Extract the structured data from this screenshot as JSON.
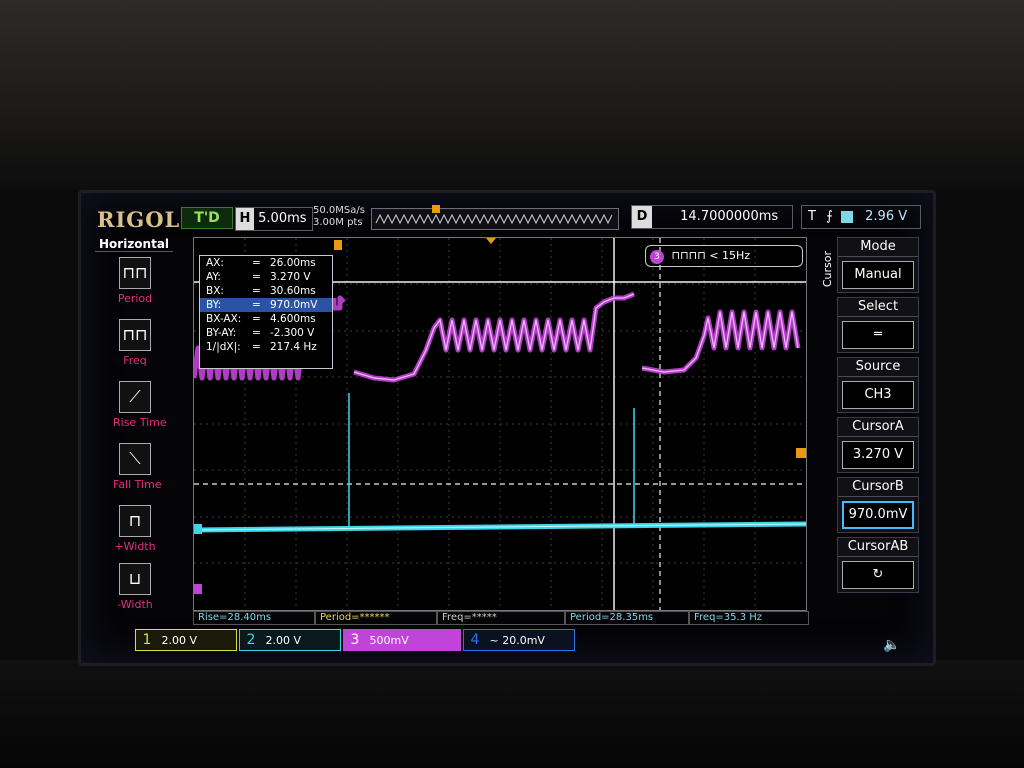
{
  "brand": "RIGOL",
  "status": "T'D",
  "horizontal": {
    "label": "H",
    "value": "5.00ms"
  },
  "sample": {
    "rate": "50.0MSa/s",
    "points": "3.00M pts"
  },
  "delay": {
    "label": "D",
    "value": "14.7000000ms"
  },
  "trigger": {
    "label": "T",
    "edge_symbol": "⨍",
    "level": "2.96 V"
  },
  "left_menu": {
    "title": "Horizontal",
    "items": [
      {
        "label": "Period"
      },
      {
        "label": "Freq"
      },
      {
        "label": "Rise Time"
      },
      {
        "label": "Fall Time"
      },
      {
        "label": "+Width"
      },
      {
        "label": "-Width"
      }
    ]
  },
  "cursor_readout": [
    {
      "key": "AX:",
      "value": "26.00ms"
    },
    {
      "key": "AY:",
      "value": "3.270 V"
    },
    {
      "key": "BX:",
      "value": "30.60ms"
    },
    {
      "key": "BY:",
      "value": "970.0mV"
    },
    {
      "key": "BX-AX:",
      "value": "4.600ms"
    },
    {
      "key": "BY-AY:",
      "value": "-2.300 V"
    },
    {
      "key": "1/|dX|:",
      "value": "217.4 Hz"
    }
  ],
  "ch3_freq_badge": {
    "channel": "3",
    "text": "< 15Hz"
  },
  "right_menu": {
    "tab": "Cursor",
    "mode": {
      "title": "Mode",
      "value": "Manual"
    },
    "select": {
      "title": "Select"
    },
    "source": {
      "title": "Source",
      "value": "CH3"
    },
    "cursor_a": {
      "title": "CursorA",
      "value": "3.270 V"
    },
    "cursor_b": {
      "title": "CursorB",
      "value": "970.0mV"
    },
    "cursor_ab": {
      "title": "CursorAB"
    }
  },
  "measurements": [
    {
      "text": "Rise=28.40ms",
      "color": "#7fd7e8"
    },
    {
      "text": "Period=******",
      "color": "#e9d25a"
    },
    {
      "text": "Freq=*****",
      "color": "#cccccc"
    },
    {
      "text": "Period=28.35ms",
      "color": "#7fd7e8"
    },
    {
      "text": "Freq=35.3 Hz",
      "color": "#7fd7e8"
    }
  ],
  "channels": [
    {
      "num": "1",
      "value": "2.00 V",
      "color": "#d9e13a"
    },
    {
      "num": "2",
      "value": "2.00 V",
      "color": "#3dd6e8"
    },
    {
      "num": "3",
      "value": "500mV",
      "color": "#c144d8"
    },
    {
      "num": "4",
      "value": "20.0mV",
      "color": "#2a73e8"
    }
  ],
  "colors": {
    "ch3_trace": "#c144d8",
    "ch2_trace": "#3dd6e8",
    "trigger_marker": "#e89a17"
  }
}
